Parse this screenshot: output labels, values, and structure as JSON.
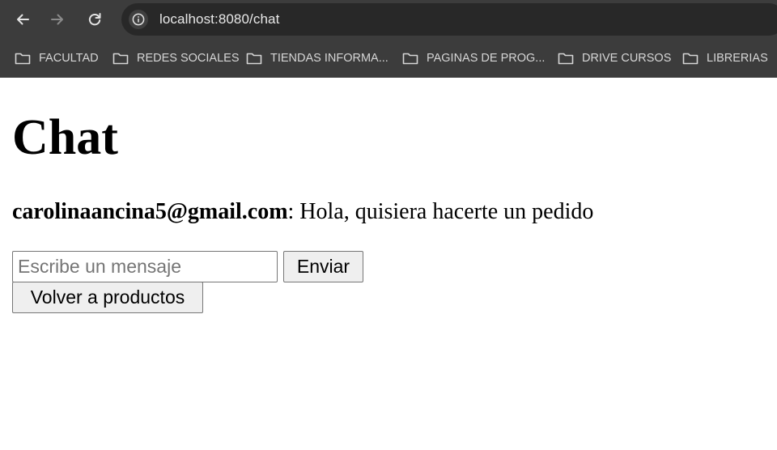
{
  "browser": {
    "url": "localhost:8080/chat",
    "icons": {
      "back": "arrow-left-icon",
      "forward": "arrow-right-icon",
      "reload": "reload-icon",
      "site_info": "info-icon",
      "folder": "folder-icon"
    },
    "bookmarks": [
      {
        "label": "FACULTAD"
      },
      {
        "label": "REDES SOCIALES"
      },
      {
        "label": "TIENDAS INFORMA..."
      },
      {
        "label": "PAGINAS DE PROG..."
      },
      {
        "label": "DRIVE CURSOS"
      },
      {
        "label": "LIBRERIAS"
      }
    ],
    "colors": {
      "chrome_bg": "#3c3c3c",
      "omnibox_bg": "#282828",
      "chrome_text": "#e8e8e8"
    }
  },
  "page": {
    "title": "Chat",
    "messages": [
      {
        "author": "carolinaancina5@gmail.com",
        "separator": ":",
        "text": " Hola, quisiera hacerte un pedido"
      }
    ],
    "input": {
      "placeholder": "Escribe un mensaje",
      "value": ""
    },
    "send_label": "Enviar",
    "back_label": "Volver a productos"
  }
}
